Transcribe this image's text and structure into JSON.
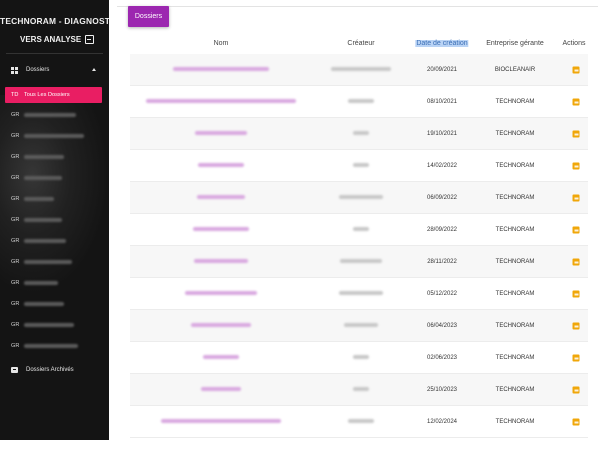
{
  "sidebar": {
    "brand": "TECHNORAM - DIAGNOSTIC",
    "analyse_link": "VERS ANALYSE",
    "dossiers": "Dossiers",
    "active_item": {
      "abbr": "TD",
      "label": "Tous Les Dossiers"
    },
    "items": [
      {
        "abbr": "GR"
      },
      {
        "abbr": "GR"
      },
      {
        "abbr": "GR"
      },
      {
        "abbr": "GR"
      },
      {
        "abbr": "GR"
      },
      {
        "abbr": "GR"
      },
      {
        "abbr": "GR"
      },
      {
        "abbr": "GR"
      },
      {
        "abbr": "GR"
      },
      {
        "abbr": "GR"
      },
      {
        "abbr": "GR"
      },
      {
        "abbr": "GR"
      }
    ],
    "archives": "Dossiers Archivés"
  },
  "main": {
    "badge": "Dossiers",
    "columns": {
      "nom": "Nom",
      "createur": "Créateur",
      "date": "Date de création",
      "entreprise": "Entreprise gérante",
      "actions": "Actions"
    },
    "rows": [
      {
        "date": "20/09/2021",
        "entreprise": "BIOCLEANAIR"
      },
      {
        "date": "08/10/2021",
        "entreprise": "TECHNORAM"
      },
      {
        "date": "19/10/2021",
        "entreprise": "TECHNORAM"
      },
      {
        "date": "14/02/2022",
        "entreprise": "TECHNORAM"
      },
      {
        "date": "06/09/2022",
        "entreprise": "TECHNORAM"
      },
      {
        "date": "28/09/2022",
        "entreprise": "TECHNORAM"
      },
      {
        "date": "28/11/2022",
        "entreprise": "TECHNORAM"
      },
      {
        "date": "05/12/2022",
        "entreprise": "TECHNORAM"
      },
      {
        "date": "06/04/2023",
        "entreprise": "TECHNORAM"
      },
      {
        "date": "02/06/2023",
        "entreprise": "TECHNORAM"
      },
      {
        "date": "25/10/2023",
        "entreprise": "TECHNORAM"
      },
      {
        "date": "12/02/2024",
        "entreprise": "TECHNORAM"
      }
    ]
  },
  "colors": {
    "sidebar_bg": "#141414",
    "active_item": "#e91e63",
    "badge": "#9c27b0",
    "edit_icon": "#f0a70a",
    "blurred_name": "#d9a8e0",
    "blurred_creator": "#c8c8c8"
  },
  "icons": {
    "analyse": "exit-to-app-icon",
    "dossiers": "grid-icon",
    "archives": "archive-icon",
    "row_action": "edit-icon"
  }
}
